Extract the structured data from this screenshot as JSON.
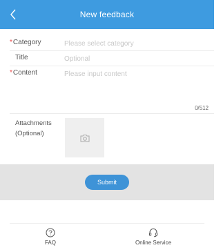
{
  "header": {
    "title": "New feedback",
    "back_icon": "chevron-left-icon",
    "background": "#3e9be0"
  },
  "form": {
    "category": {
      "label": "Category",
      "required_mark": "*",
      "placeholder": "Please select category"
    },
    "title": {
      "label": "Title",
      "placeholder": "Optional"
    },
    "content": {
      "label": "Content",
      "required_mark": "*",
      "placeholder": "Please input content",
      "counter": "0/512"
    },
    "attachments": {
      "label_line1": "Attachments",
      "label_line2": "(Optional)",
      "icon": "camera-icon"
    }
  },
  "submit": {
    "label": "Submit",
    "color": "#3e93d7"
  },
  "bottom_bar": {
    "faq": {
      "label": "FAQ",
      "icon": "help-circle-icon"
    },
    "online_service": {
      "label": "Online Service",
      "icon": "headset-icon"
    }
  }
}
